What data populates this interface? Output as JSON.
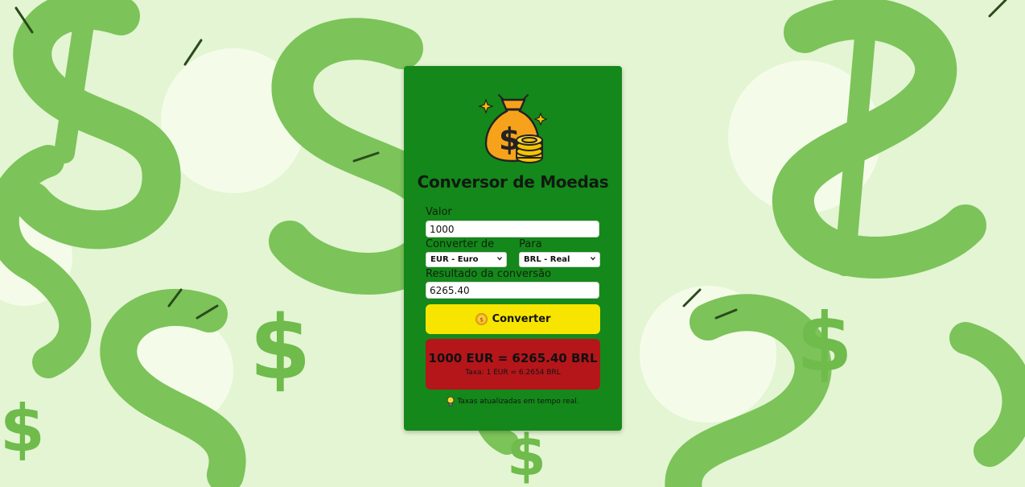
{
  "app": {
    "title": "Conversor de Moedas"
  },
  "form": {
    "amount_label": "Valor",
    "amount_value": "1000",
    "from_label": "Converter de",
    "from_selected": "EUR - Euro",
    "to_label": "Para",
    "to_selected": "BRL - Real",
    "result_label": "Resultado da conversão",
    "result_value": "6265.40",
    "convert_label": "Converter"
  },
  "result": {
    "summary": "1000 EUR = 6265.40 BRL",
    "rate": "Taxa: 1 EUR = 6.2654 BRL"
  },
  "footer": {
    "note": "Taxas atualizadas em tempo real."
  },
  "icons": {
    "logo": "money-bag-coins-icon",
    "convert": "coin-icon",
    "footer": "lightbulb-icon",
    "select": "chevron-down-icon"
  },
  "colors": {
    "background": "#e6f6d6",
    "card": "#14881a",
    "button": "#f7e500",
    "result_box": "#b5161a",
    "pattern": "#7cc35a"
  }
}
